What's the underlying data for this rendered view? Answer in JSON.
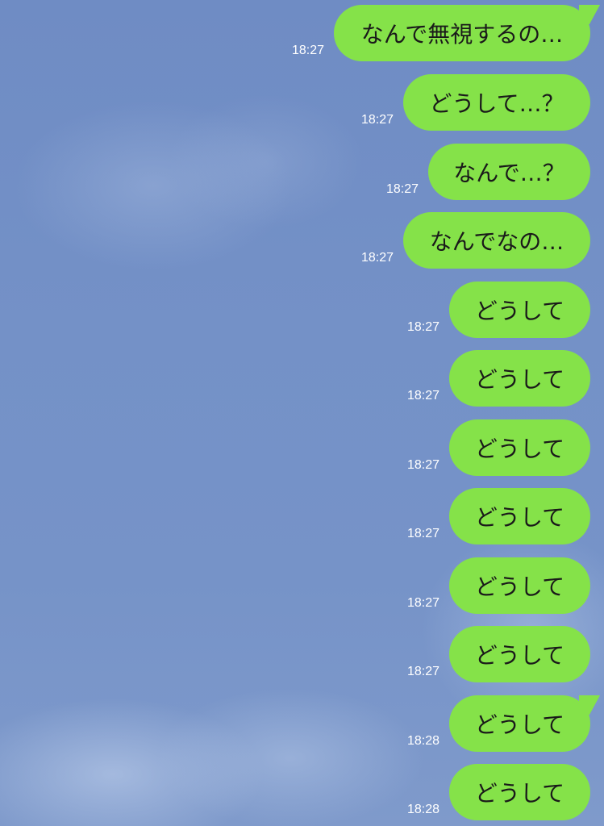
{
  "chat": {
    "messages": [
      {
        "text": "なんで無視するの…",
        "time": "18:27"
      },
      {
        "text": "どうして…？",
        "time": "18:27"
      },
      {
        "text": "なんで…？",
        "time": "18:27"
      },
      {
        "text": "なんでなの…",
        "time": "18:27"
      },
      {
        "text": "どうして",
        "time": "18:27"
      },
      {
        "text": "どうして",
        "time": "18:27"
      },
      {
        "text": "どうして",
        "time": "18:27"
      },
      {
        "text": "どうして",
        "time": "18:27"
      },
      {
        "text": "どうして",
        "time": "18:27"
      },
      {
        "text": "どうして",
        "time": "18:27"
      },
      {
        "text": "どうして",
        "time": "18:28"
      },
      {
        "text": "どうして",
        "time": "18:28"
      }
    ]
  }
}
